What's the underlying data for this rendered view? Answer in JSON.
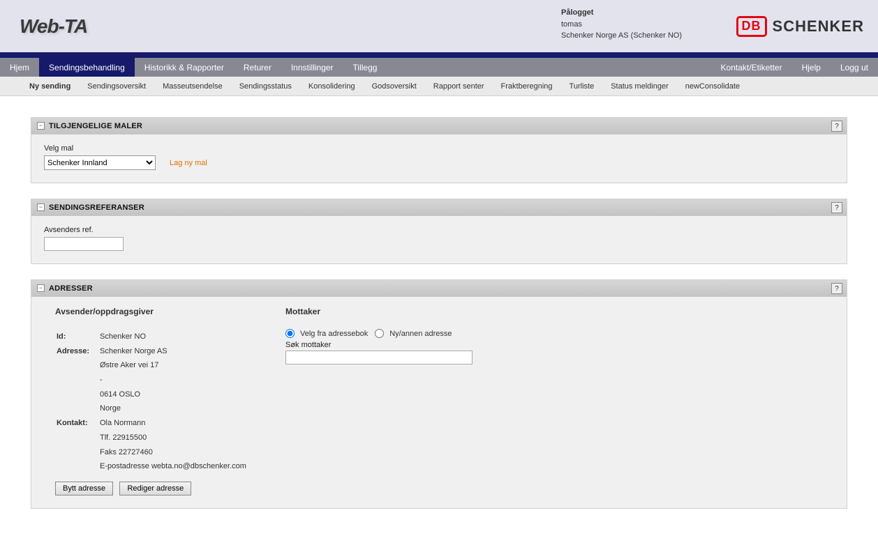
{
  "app_name": "Web-TA",
  "brand": {
    "db_text": "DB",
    "schenker_text": "SCHENKER"
  },
  "login": {
    "label": "Pålogget",
    "user": "tomas",
    "company": "Schenker Norge AS (Schenker NO)"
  },
  "mainnav": {
    "items": [
      "Hjem",
      "Sendingsbehandling",
      "Historikk & Rapporter",
      "Returer",
      "Innstillinger",
      "Tillegg"
    ],
    "right": [
      "Kontakt/Etiketter",
      "Hjelp",
      "Logg ut"
    ],
    "active_index": 1
  },
  "subnav": {
    "items": [
      "Ny sending",
      "Sendingsoversikt",
      "Masseutsendelse",
      "Sendingsstatus",
      "Konsolidering",
      "Godsoversikt",
      "Rapport senter",
      "Fraktberegning",
      "Turliste",
      "Status meldinger",
      "newConsolidate"
    ],
    "active_index": 0
  },
  "panels": {
    "templates": {
      "title": "TILGJENGELIGE MALER",
      "velg_label": "Velg mal",
      "selected": "Schenker Innland",
      "new_link": "Lag ny mal",
      "help": "?"
    },
    "refs": {
      "title": "SENDINGSREFERANSER",
      "label": "Avsenders ref.",
      "value": "",
      "help": "?"
    },
    "addresses": {
      "title": "ADRESSER",
      "help": "?",
      "sender": {
        "heading": "Avsender/oppdragsgiver",
        "id_label": "Id:",
        "id_value": "Schenker NO",
        "addr_label": "Adresse:",
        "line1": "Schenker Norge AS",
        "line2": "Østre Aker vei 17",
        "line3": "-",
        "line4": "0614 OSLO",
        "line5": "Norge",
        "contact_label": "Kontakt:",
        "contact_name": "Ola Normann",
        "tel": "Tlf. 22915500",
        "fax": "Faks 22727460",
        "email": "E-postadresse webta.no@dbschenker.com",
        "btn_change": "Bytt adresse",
        "btn_edit": "Rediger adresse"
      },
      "receiver": {
        "heading": "Mottaker",
        "radio1": "Velg fra adressebok",
        "radio2": "Ny/annen adresse",
        "search_label": "Søk mottaker",
        "search_value": ""
      }
    }
  }
}
